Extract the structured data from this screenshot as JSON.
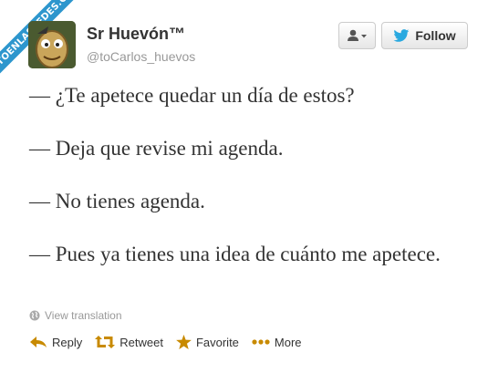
{
  "watermark": "VISTOENLASREDES.COM",
  "profile": {
    "name": "Sr Huevón™",
    "handle": "@toCarlos_huevos"
  },
  "buttons": {
    "follow_label": "Follow"
  },
  "tweet": {
    "lines": [
      "— ¿Te apetece quedar un día de estos?",
      "— Deja que revise mi agenda.",
      "— No tienes agenda.",
      "— Pues ya tienes una idea de cuánto me apetece."
    ]
  },
  "translation_label": "View translation",
  "actions": {
    "reply": "Reply",
    "retweet": "Retweet",
    "favorite": "Favorite",
    "more": "More"
  },
  "colors": {
    "ribbon": "#2d96cd",
    "action_icon": "#c88a00",
    "twitter_bird": "#2aa9e0"
  }
}
